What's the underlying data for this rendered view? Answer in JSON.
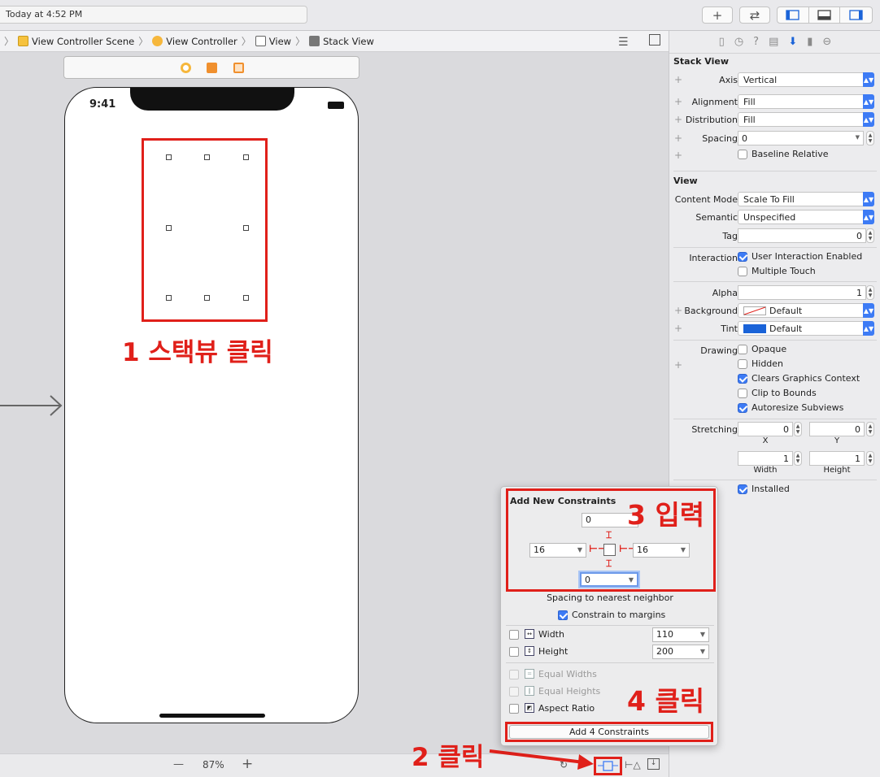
{
  "toolbar": {
    "status": "Today at 4:52 PM",
    "add_label": "+",
    "swap_label": "⇄"
  },
  "jumpbar": {
    "crumbs": [
      "View Controller Scene",
      "View Controller",
      "View",
      "Stack View"
    ]
  },
  "phone": {
    "time": "9:41"
  },
  "annotations": {
    "step1": "1 스택뷰 클릭",
    "step2": "2 클릭",
    "step3": "3 입력",
    "step4": "4 클릭"
  },
  "bottombar": {
    "zoom": "87%",
    "minus": "—",
    "plus": "+"
  },
  "inspector": {
    "stack_view_title": "Stack View",
    "axis_label": "Axis",
    "axis_value": "Vertical",
    "alignment_label": "Alignment",
    "alignment_value": "Fill",
    "distribution_label": "Distribution",
    "distribution_value": "Fill",
    "spacing_label": "Spacing",
    "spacing_value": "0",
    "baseline_label": "Baseline Relative",
    "view_title": "View",
    "content_mode_label": "Content Mode",
    "content_mode_value": "Scale To Fill",
    "semantic_label": "Semantic",
    "semantic_value": "Unspecified",
    "tag_label": "Tag",
    "tag_value": "0",
    "interaction_label": "Interaction",
    "user_interaction_label": "User Interaction Enabled",
    "multiple_touch_label": "Multiple Touch",
    "alpha_label": "Alpha",
    "alpha_value": "1",
    "background_label": "Background",
    "background_value": "Default",
    "tint_label": "Tint",
    "tint_value": "Default",
    "drawing_label": "Drawing",
    "opaque_label": "Opaque",
    "hidden_label": "Hidden",
    "clears_label": "Clears Graphics Context",
    "clip_label": "Clip to Bounds",
    "autoresize_label": "Autoresize Subviews",
    "stretching_label": "Stretching",
    "stretch_x": "0",
    "stretch_y": "0",
    "stretch_w": "1",
    "stretch_h": "1",
    "x_label": "X",
    "y_label": "Y",
    "width_label": "Width",
    "height_label": "Height",
    "installed_label": "Installed",
    "accent_color": "#3d7bf5"
  },
  "popover": {
    "title": "Add New Constraints",
    "top_value": "0",
    "left_value": "16",
    "right_value": "16",
    "bottom_value": "0",
    "spacing_note": "Spacing to nearest neighbor",
    "constrain_margins": "Constrain to margins",
    "width_label": "Width",
    "width_value": "110",
    "height_label": "Height",
    "height_value": "200",
    "equal_widths": "Equal Widths",
    "equal_heights": "Equal Heights",
    "aspect_ratio": "Aspect Ratio",
    "add_button": "Add 4 Constraints"
  },
  "colors": {
    "annotation_red": "#e0201a"
  }
}
